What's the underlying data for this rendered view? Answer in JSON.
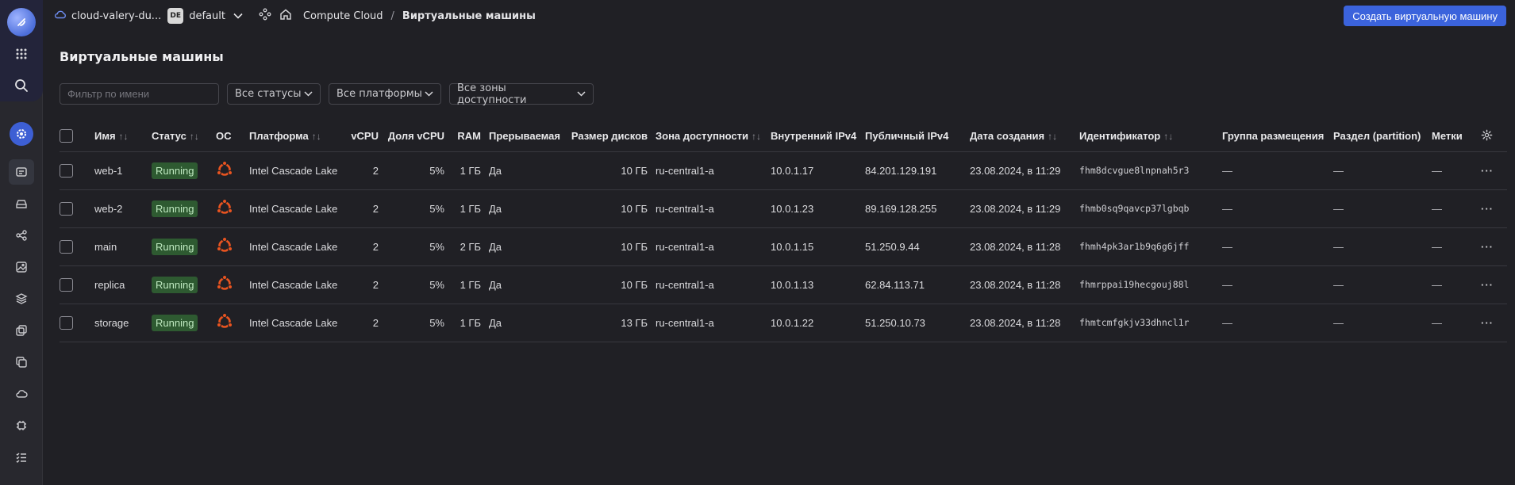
{
  "topbar": {
    "cloud_name": "cloud-valery-du...",
    "folder_badge": "DE",
    "folder_name": "default",
    "breadcrumb_service": "Compute Cloud",
    "breadcrumb_sep": "/",
    "breadcrumb_current": "Виртуальные машины",
    "create_button": "Создать виртуальную машину"
  },
  "page": {
    "title": "Виртуальные машины"
  },
  "filters": {
    "name_placeholder": "Фильтр по имени",
    "status_select": "Все статусы",
    "platform_select": "Все платформы",
    "zone_select": "Все зоны доступности"
  },
  "table": {
    "headers": {
      "name": "Имя",
      "status": "Статус",
      "os": "ОС",
      "platform": "Платформа",
      "vcpu": "vCPU",
      "vcpu_share": "Доля vCPU",
      "ram": "RAM",
      "preemptible": "Прерываемая",
      "disk_size": "Размер дисков",
      "zone": "Зона доступности",
      "internal_ip": "Внутренний IPv4",
      "public_ip": "Публичный IPv4",
      "created": "Дата создания",
      "id": "Идентификатор",
      "placement_group": "Группа размещения",
      "partition": "Раздел (partition)",
      "labels": "Метки",
      "sort_glyph": "↑↓"
    },
    "rows": [
      {
        "name": "web-1",
        "status": "Running",
        "platform": "Intel Cascade Lake",
        "vcpu": "2",
        "vcpu_share": "5%",
        "ram": "1 ГБ",
        "preemptible": "Да",
        "disk": "10 ГБ",
        "zone": "ru-central1-a",
        "internal_ip": "10.0.1.17",
        "public_ip": "84.201.129.191",
        "created": "23.08.2024, в 11:29",
        "id": "fhm8dcvgue8lnpnah5r3",
        "placement": "—",
        "partition": "—",
        "labels": "—",
        "menu": "···"
      },
      {
        "name": "web-2",
        "status": "Running",
        "platform": "Intel Cascade Lake",
        "vcpu": "2",
        "vcpu_share": "5%",
        "ram": "1 ГБ",
        "preemptible": "Да",
        "disk": "10 ГБ",
        "zone": "ru-central1-a",
        "internal_ip": "10.0.1.23",
        "public_ip": "89.169.128.255",
        "created": "23.08.2024, в 11:29",
        "id": "fhmb0sq9qavcp37lgbqb",
        "placement": "—",
        "partition": "—",
        "labels": "—",
        "menu": "···"
      },
      {
        "name": "main",
        "status": "Running",
        "platform": "Intel Cascade Lake",
        "vcpu": "2",
        "vcpu_share": "5%",
        "ram": "2 ГБ",
        "preemptible": "Да",
        "disk": "10 ГБ",
        "zone": "ru-central1-a",
        "internal_ip": "10.0.1.15",
        "public_ip": "51.250.9.44",
        "created": "23.08.2024, в 11:28",
        "id": "fhmh4pk3ar1b9q6g6jff",
        "placement": "—",
        "partition": "—",
        "labels": "—",
        "menu": "···"
      },
      {
        "name": "replica",
        "status": "Running",
        "platform": "Intel Cascade Lake",
        "vcpu": "2",
        "vcpu_share": "5%",
        "ram": "1 ГБ",
        "preemptible": "Да",
        "disk": "10 ГБ",
        "zone": "ru-central1-a",
        "internal_ip": "10.0.1.13",
        "public_ip": "62.84.113.71",
        "created": "23.08.2024, в 11:28",
        "id": "fhmrppai19hecgouj88l",
        "placement": "—",
        "partition": "—",
        "labels": "—",
        "menu": "···"
      },
      {
        "name": "storage",
        "status": "Running",
        "platform": "Intel Cascade Lake",
        "vcpu": "2",
        "vcpu_share": "5%",
        "ram": "1 ГБ",
        "preemptible": "Да",
        "disk": "13 ГБ",
        "zone": "ru-central1-a",
        "internal_ip": "10.0.1.22",
        "public_ip": "51.250.10.73",
        "created": "23.08.2024, в 11:28",
        "id": "fhmtcmfgkjv33dhncl1r",
        "placement": "—",
        "partition": "—",
        "labels": "—",
        "menu": "···"
      }
    ]
  },
  "colors": {
    "accent": "#3b63dc",
    "status_running_bg": "#2e5a31",
    "os_ubuntu": "#e95420"
  },
  "icons": {
    "os": "ubuntu-icon"
  }
}
